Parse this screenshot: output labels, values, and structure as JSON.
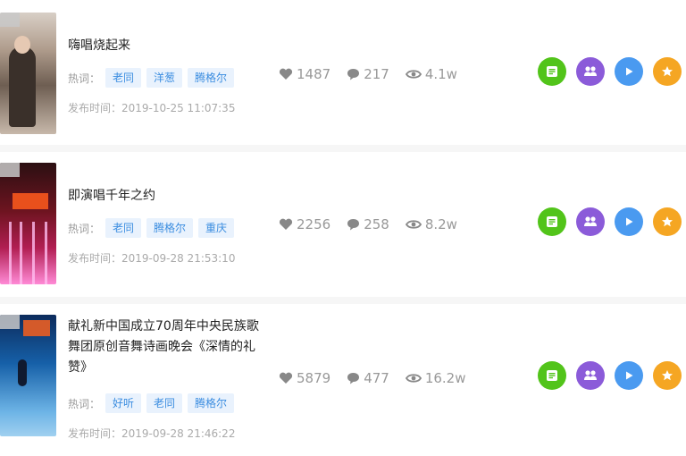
{
  "items": [
    {
      "thumb_badge": "",
      "title": "嗨唱烧起来",
      "hot_label": "热词：",
      "tags": [
        "老同",
        "洋葱",
        "腾格尔"
      ],
      "likes": "1487",
      "comments": "217",
      "views": "4.1w",
      "publish_time": "发布时间：2019-10-25 11:07:35"
    },
    {
      "thumb_badge": "",
      "title": "即演唱千年之约",
      "hot_label": "热词：",
      "tags": [
        "老同",
        "腾格尔",
        "重庆"
      ],
      "likes": "2256",
      "comments": "258",
      "views": "8.2w",
      "publish_time": "发布时间：2019-09-28 21:53:10"
    },
    {
      "thumb_badge": "",
      "title": "献礼新中国成立70周年中央民族歌舞团原创音舞诗画晚会《深情的礼赞》",
      "hot_label": "热词：",
      "tags": [
        "好听",
        "老同",
        "腾格尔"
      ],
      "likes": "5879",
      "comments": "477",
      "views": "16.2w",
      "publish_time": "发布时间：2019-09-28 21:46:22"
    }
  ],
  "colors": {
    "lyrics": "#52c41a",
    "singers": "#8b5bd9",
    "play": "#4a9af0",
    "favorite": "#f5a623",
    "tag_bg": "#e9f2fd",
    "tag_text": "#3b8de0"
  },
  "icons": {
    "like": "heart-icon",
    "comment": "comment-bubble-icon",
    "view": "eye-icon",
    "lyrics": "lyrics-list-icon",
    "singers": "singers-group-icon",
    "play": "play-icon",
    "favorite": "star-icon"
  }
}
